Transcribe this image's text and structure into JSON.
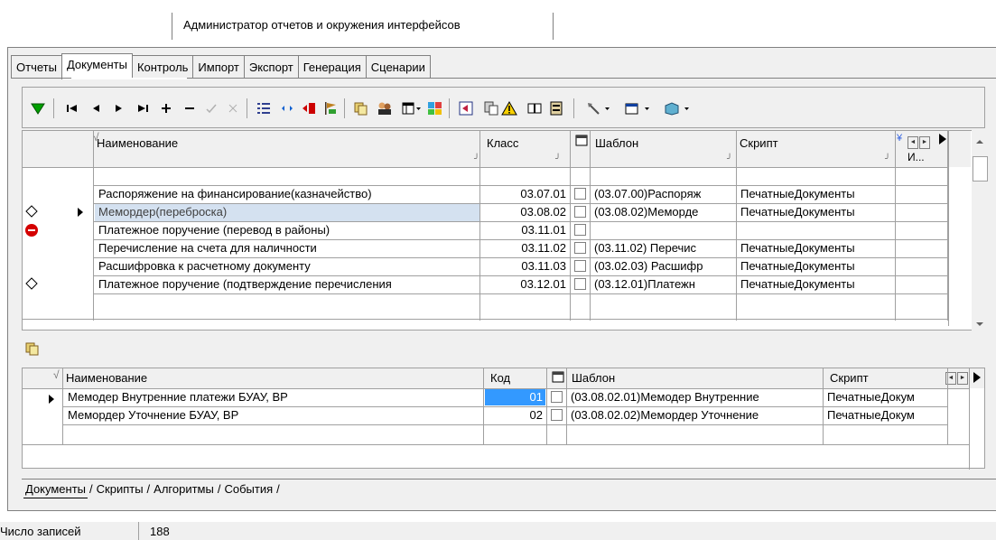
{
  "window": {
    "title": "Администратор отчетов и окружения интерфейсов"
  },
  "tabs": [
    {
      "label": "Отчеты",
      "active": false
    },
    {
      "label": "Документы",
      "active": true
    },
    {
      "label": "Контроль",
      "active": false
    },
    {
      "label": "Импорт",
      "active": false
    },
    {
      "label": "Экспорт",
      "active": false
    },
    {
      "label": "Генерация",
      "active": false
    },
    {
      "label": "Сценарии",
      "active": false
    }
  ],
  "toolbar": {
    "icons": [
      "filter-icon",
      "first-record-icon",
      "prev-record-icon",
      "next-record-icon",
      "last-record-icon",
      "add-icon",
      "delete-icon",
      "post-icon",
      "cancel-icon",
      "list-icon",
      "link-icon",
      "exit-icon",
      "flag-icon",
      "copy-icon",
      "users-icon",
      "table-dropdown-icon",
      "colors-icon",
      "import-icon",
      "paste-icon",
      "warning-icon",
      "book-icon",
      "archive-icon",
      "tools-dropdown-icon",
      "properties-dropdown-icon",
      "cube-dropdown-icon"
    ]
  },
  "top_grid": {
    "headers": {
      "name": "Наименование",
      "class": "Класс",
      "template": "Шаблон",
      "script": "Скрипт",
      "extra": "И..."
    },
    "rows": [
      {
        "name": "Распоряжение на финансирование(казначейство)",
        "class": "03.07.01",
        "template": "(03.07.00)Распоряж",
        "script": "ПечатныеДокументы",
        "marker": ""
      },
      {
        "name": "Мемордер(переброска)",
        "class": "03.08.02",
        "template": "(03.08.02)Меморде",
        "script": "ПечатныеДокументы",
        "marker": "edit"
      },
      {
        "name": "Платежное поручение (перевод в районы)",
        "class": "03.11.01",
        "template": "",
        "script": "",
        "marker": "stop"
      },
      {
        "name": "Перечисление на счета для наличности",
        "class": "03.11.02",
        "template": "(03.11.02) Перечис",
        "script": "ПечатныеДокументы",
        "marker": ""
      },
      {
        "name": "Расшифровка к расчетному документу",
        "class": "03.11.03",
        "template": "(03.02.03) Расшифр",
        "script": "ПечатныеДокументы",
        "marker": ""
      },
      {
        "name": "Платежное поручение (подтверждение перечисления",
        "class": "03.12.01",
        "template": "(03.12.01)Платежн",
        "script": "ПечатныеДокументы",
        "marker": "edit"
      }
    ]
  },
  "bottom_grid": {
    "headers": {
      "name": "Наименование",
      "code": "Код",
      "template": "Шаблон",
      "script": "Скрипт"
    },
    "rows": [
      {
        "name": "Мемодер Внутренние платежи БУАУ, ВР",
        "code": "01",
        "template": "(03.08.02.01)Мемодер Внутренние",
        "script": "ПечатныеДокум"
      },
      {
        "name": "Мемордер Уточнение БУАУ, ВР",
        "code": "02",
        "template": "(03.08.02.02)Мемордер Уточнение",
        "script": "ПечатныеДокум"
      }
    ]
  },
  "bottom_tabs": [
    "Документы",
    "Скрипты",
    "Алгоритмы",
    "События"
  ],
  "status": {
    "label": "Число записей",
    "value": "188"
  }
}
